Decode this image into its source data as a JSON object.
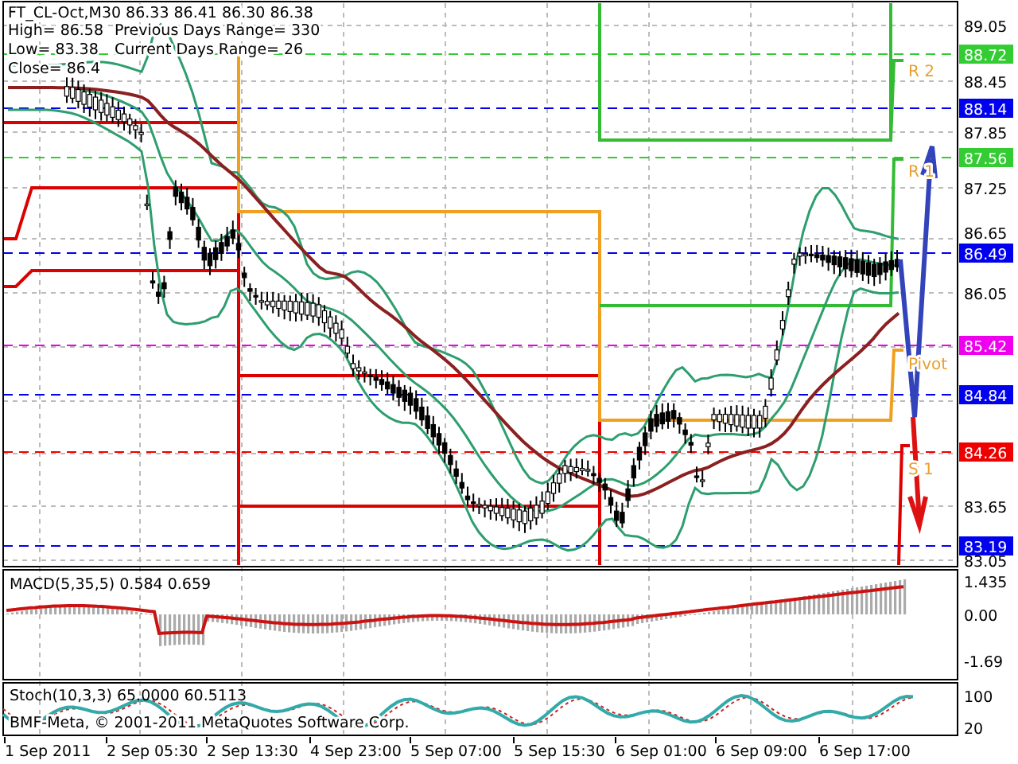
{
  "header": {
    "title": "FT_CL-Oct,M30  86.33 86.41 86.30 86.38",
    "high": "High= 86.58",
    "low": "Low= 83.38",
    "close": "Close= 86.4",
    "previous_range": "Previous Days Range= 330",
    "current_range": "Current Days Range= 26"
  },
  "price_axis": {
    "ticks": [
      "89.05",
      "88.45",
      "87.85",
      "87.25",
      "86.65",
      "86.05",
      "83.65",
      "83.05"
    ]
  },
  "price_tags": [
    {
      "label": "88.72",
      "color": "#33cc33"
    },
    {
      "label": "88.14",
      "color": "#0000ee"
    },
    {
      "label": "87.56",
      "color": "#33cc33"
    },
    {
      "label": "86.49",
      "color": "#0000ee"
    },
    {
      "label": "85.42",
      "color": "#ee00ee"
    },
    {
      "label": "84.84",
      "color": "#0000ee"
    },
    {
      "label": "84.26",
      "color": "#ee0000"
    },
    {
      "label": "83.19",
      "color": "#0000ee"
    }
  ],
  "level_labels": [
    "R 2",
    "R 1",
    "Pivot",
    "S 1"
  ],
  "macd": {
    "label": "MACD(5,35,5) 0.584 0.659",
    "ticks": [
      "1.435",
      "0.00",
      "-1.69"
    ]
  },
  "stoch": {
    "label": "Stoch(10,3,3) 65.0000 60.5113",
    "ticks": [
      "100",
      "20"
    ]
  },
  "copyright": "BMF-Meta, © 2001-2011 MetaQuotes Software Corp.",
  "time_axis": [
    "1 Sep 2011",
    "2 Sep 05:30",
    "2 Sep 13:30",
    "4 Sep 23:00",
    "5 Sep 07:00",
    "5 Sep 15:30",
    "6 Sep 01:00",
    "6 Sep 09:00",
    "6 Sep 17:00"
  ]
}
